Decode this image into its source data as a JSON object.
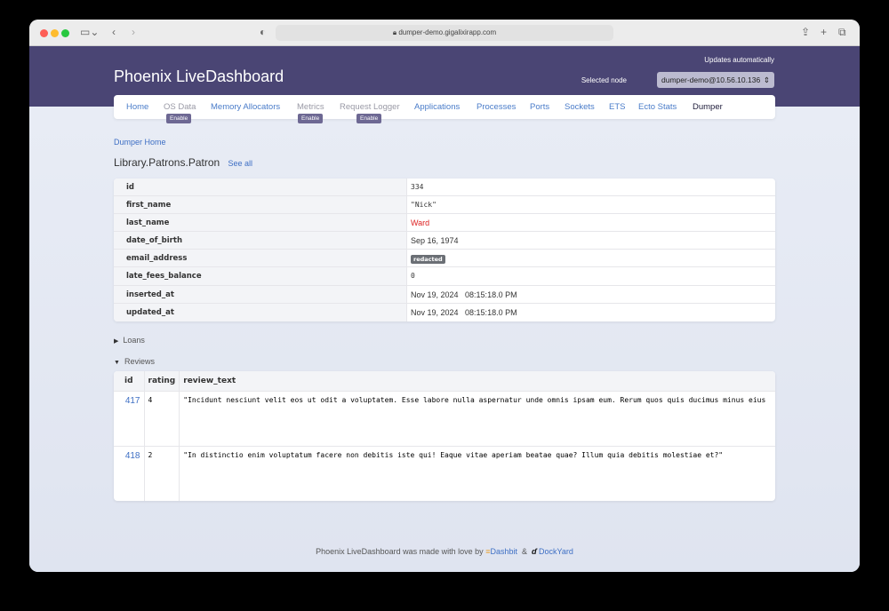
{
  "browser": {
    "url": "dumper-demo.gigalixirapp.com"
  },
  "header": {
    "title": "Phoenix LiveDashboard",
    "updates": "Updates automatically",
    "selected_node_label": "Selected node",
    "selected_node": "dumper-demo@10.56.10.136"
  },
  "nav": {
    "items": [
      {
        "label": "Home"
      },
      {
        "label": "OS Data",
        "badge": "Enable"
      },
      {
        "label": "Memory Allocators"
      },
      {
        "label": "Metrics",
        "badge": "Enable"
      },
      {
        "label": "Request Logger",
        "badge": "Enable"
      },
      {
        "label": "Applications"
      },
      {
        "label": "Processes"
      },
      {
        "label": "Ports"
      },
      {
        "label": "Sockets"
      },
      {
        "label": "ETS"
      },
      {
        "label": "Ecto Stats"
      },
      {
        "label": "Dumper"
      }
    ]
  },
  "breadcrumb": "Dumper Home",
  "schema": {
    "name": "Library.Patrons.Patron",
    "see_all": "See all"
  },
  "record": [
    {
      "key": "id",
      "value": "334"
    },
    {
      "key": "first_name",
      "value": "\"Nick\""
    },
    {
      "key": "last_name",
      "value": "Ward"
    },
    {
      "key": "date_of_birth",
      "value": "Sep 16, 1974"
    },
    {
      "key": "email_address",
      "value": "redacted"
    },
    {
      "key": "late_fees_balance",
      "value": "0"
    },
    {
      "key": "inserted_at",
      "value": "Nov 19, 2024   08:15:18.0 PM"
    },
    {
      "key": "updated_at",
      "value": "Nov 19, 2024   08:15:18.0 PM"
    }
  ],
  "sections": {
    "loans": "Loans",
    "reviews": "Reviews"
  },
  "reviews": {
    "columns": [
      "id",
      "rating",
      "review_text"
    ],
    "rows": [
      {
        "id": "417",
        "rating": "4",
        "review_text": "\"Incidunt nesciunt velit eos ut odit a voluptatem. Esse labore nulla aspernatur unde omnis ipsam eum. Rerum quos quis ducimus minus eius"
      },
      {
        "id": "418",
        "rating": "2",
        "review_text": "\"In distinctio enim voluptatum facere non debitis iste qui! Eaque vitae aperiam beatae quae? Illum quia debitis molestiae et?\""
      }
    ]
  },
  "footer": {
    "text": "Phoenix LiveDashboard was made with love by",
    "dashbit": "Dashbit",
    "amp": "&",
    "dockyard": "DockYard"
  }
}
